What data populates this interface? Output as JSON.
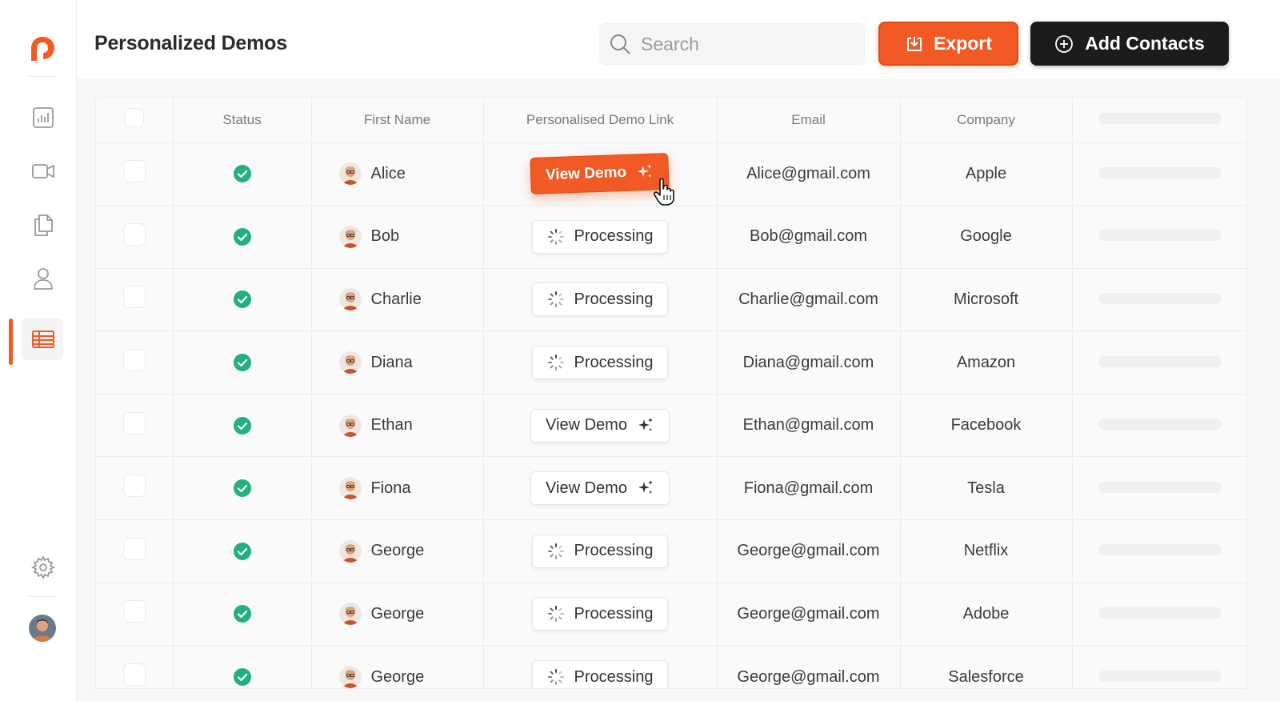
{
  "app": {
    "page_title": "Personalized Demos",
    "accent_color": "#f15a24"
  },
  "sidebar": {
    "items": [
      {
        "icon": "analytics-icon"
      },
      {
        "icon": "video-icon"
      },
      {
        "icon": "documents-icon"
      },
      {
        "icon": "user-icon"
      },
      {
        "icon": "table-icon",
        "active": true
      },
      {
        "icon": "settings-icon"
      }
    ]
  },
  "header": {
    "search_placeholder": "Search",
    "export_label": "Export",
    "add_contacts_label": "Add Contacts"
  },
  "table": {
    "columns": [
      "Status",
      "First Name",
      "Personalised Demo Link",
      "Email",
      "Company"
    ],
    "rows": [
      {
        "name": "Alice",
        "link": "View Demo",
        "link_state": "active",
        "email": "Alice@gmail.com",
        "company": "Apple"
      },
      {
        "name": "Bob",
        "link": "Processing",
        "link_state": "processing",
        "email": "Bob@gmail.com",
        "company": "Google"
      },
      {
        "name": "Charlie",
        "link": "Processing",
        "link_state": "processing",
        "email": "Charlie@gmail.com",
        "company": "Microsoft"
      },
      {
        "name": "Diana",
        "link": "Processing",
        "link_state": "processing",
        "email": "Diana@gmail.com",
        "company": "Amazon"
      },
      {
        "name": "Ethan",
        "link": "View Demo",
        "link_state": "ready",
        "email": "Ethan@gmail.com",
        "company": "Facebook"
      },
      {
        "name": "Fiona",
        "link": "View Demo",
        "link_state": "ready",
        "email": "Fiona@gmail.com",
        "company": "Tesla"
      },
      {
        "name": "George",
        "link": "Processing",
        "link_state": "processing",
        "email": "George@gmail.com",
        "company": "Netflix"
      },
      {
        "name": "George",
        "link": "Processing",
        "link_state": "processing",
        "email": "George@gmail.com",
        "company": "Adobe"
      },
      {
        "name": "George",
        "link": "Processing",
        "link_state": "processing",
        "email": "George@gmail.com",
        "company": "Salesforce"
      }
    ]
  }
}
